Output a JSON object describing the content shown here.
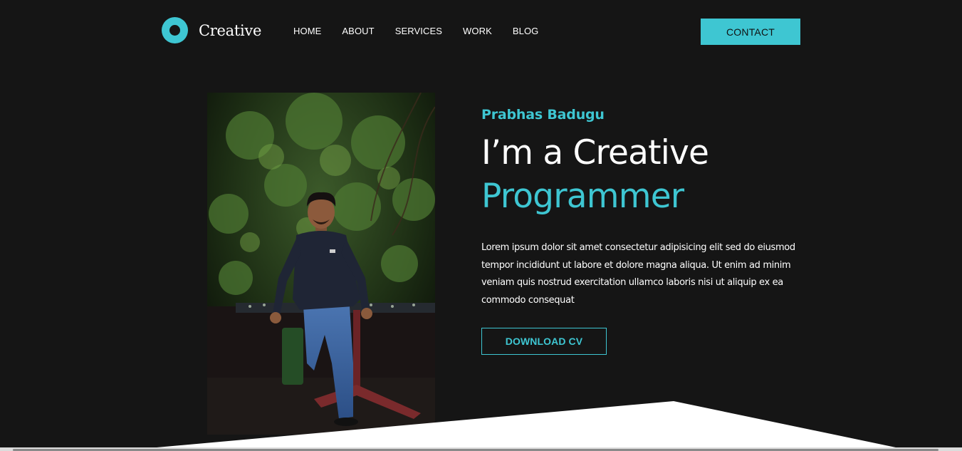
{
  "header": {
    "logo_text": "Creative",
    "nav": [
      {
        "label": "HOME"
      },
      {
        "label": "ABOUT"
      },
      {
        "label": "SERVICES"
      },
      {
        "label": "WORK"
      },
      {
        "label": "BLOG"
      }
    ],
    "contact_label": "CONTACT"
  },
  "hero": {
    "name": "Prabhas Badugu",
    "title_line1": "I’m a Creative",
    "title_line2": "Programmer",
    "description": "Lorem ipsum dolor sit amet consectetur adipisicing elit sed do eiusmod tempor incididunt ut labore et dolore magna aliqua. Ut enim ad minim veniam quis nostrud exercitation ullamco laboris nisi ut aliquip ex ea commodo consequat",
    "download_label": "DOWNLOAD CV"
  },
  "photo": {
    "icon": "portrait-photo"
  },
  "colors": {
    "background": "#151515",
    "accent": "#3ec6d2",
    "text": "#ffffff",
    "shape": "#ffffff"
  }
}
